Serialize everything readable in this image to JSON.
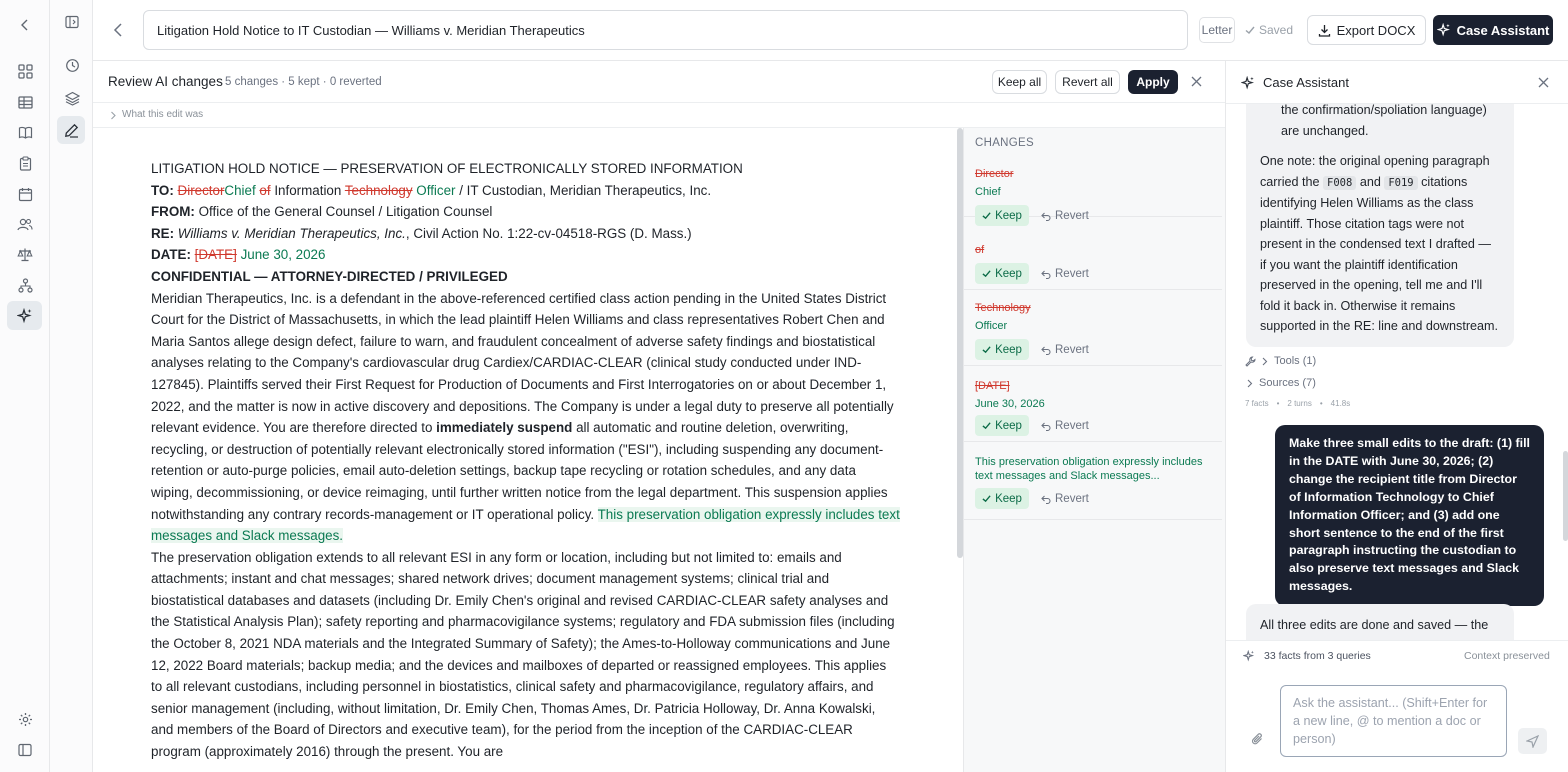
{
  "colors": {
    "accent_dark": "#1b2130",
    "deleted": "#d0392e",
    "inserted": "#0b7a52",
    "keep_bg": "#dcf2e4"
  },
  "rail": {
    "items": [
      {
        "icon": "chevron-left-icon"
      },
      {
        "icon": "grid-icon"
      },
      {
        "icon": "table-icon"
      },
      {
        "icon": "book-icon"
      },
      {
        "icon": "clipboard-icon"
      },
      {
        "icon": "calendar-icon"
      },
      {
        "icon": "users-icon"
      },
      {
        "icon": "scale-icon"
      },
      {
        "icon": "org-chart-icon"
      },
      {
        "icon": "sparkle-icon"
      },
      {
        "icon": "gear-icon"
      },
      {
        "icon": "panel-collapse-icon"
      }
    ]
  },
  "subrail": {
    "items": [
      {
        "icon": "panel-toggle-icon"
      },
      {
        "icon": "history-icon"
      },
      {
        "icon": "layers-icon"
      },
      {
        "icon": "pen-icon"
      }
    ]
  },
  "header": {
    "document_title": "Litigation Hold Notice to IT Custodian — Williams v. Meridian Therapeutics",
    "doc_type": "Letter",
    "saved_status": "Saved",
    "export_label": "Export DOCX",
    "assistant_label": "Case Assistant"
  },
  "review": {
    "title": "Review AI changes",
    "summary": "5 changes · 5 kept · 0 reverted",
    "keep_all": "Keep all",
    "revert_all": "Revert all",
    "apply": "Apply",
    "what_this_edit_was": "What this edit was"
  },
  "document": {
    "heading": "LITIGATION HOLD NOTICE — PRESERVATION OF ELECTRONICALLY STORED INFORMATION",
    "to_label": "TO:",
    "to_del_1": "Director",
    "to_ins_1": "Chief",
    "to_del_2": "of",
    "to_text_1": "Information",
    "to_del_3": "Technology",
    "to_ins_3": "Officer",
    "to_text_2": "/ IT Custodian, Meridian Therapeutics, Inc.",
    "from_label": "FROM:",
    "from_text": "Office of the General Counsel / Litigation Counsel",
    "re_label": "RE:",
    "re_case": "Williams v. Meridian Therapeutics, Inc.",
    "re_text": ", Civil Action No. 1:22-cv-04518-RGS (D. Mass.)",
    "date_label": "DATE:",
    "date_del": "[DATE]",
    "date_ins": "June 30, 2026",
    "confidential": "CONFIDENTIAL — ATTORNEY-DIRECTED / PRIVILEGED",
    "p1_a": "Meridian Therapeutics, Inc. is a defendant in the above-referenced certified class action pending in the United States District Court for the District of Massachusetts, in which the lead plaintiff Helen Williams and class representatives Robert Chen and Maria Santos allege design defect, failure to warn, and fraudulent concealment of adverse safety findings and biostatistical analyses relating to the Company's cardiovascular drug Cardiex/CARDIAC-CLEAR (clinical study conducted under IND-127845). Plaintiffs served their First Request for Production of Documents and First Interrogatories on or about December 1, 2022, and the matter is now in active discovery and depositions. The Company is under a legal duty to preserve all potentially relevant evidence. You are therefore directed to",
    "p1_bold": "immediately suspend",
    "p1_b": "all automatic and routine deletion, overwriting, recycling, or destruction of potentially relevant electronically stored information (\"ESI\"), including suspending any document-retention or auto-purge policies, email auto-deletion settings, backup tape recycling or rotation schedules, and any data wiping, decommissioning, or device reimaging, until further written notice from the legal department. This suspension applies notwithstanding any contrary records-management or IT operational policy.",
    "p1_ins": "This preservation obligation expressly includes text messages and Slack messages.",
    "p2": "The preservation obligation extends to all relevant ESI in any form or location, including but not limited to: emails and attachments; instant and chat messages; shared network drives; document management systems; clinical trial and biostatistical databases and datasets (including Dr. Emily Chen's original and revised CARDIAC-CLEAR safety analyses and the Statistical Analysis Plan); safety reporting and pharmacovigilance systems; regulatory and FDA submission files (including the October 8, 2021 NDA materials and the Integrated Summary of Safety); the Ames-to-Holloway communications and June 12, 2022 Board materials; backup media; and the devices and mailboxes of departed or reassigned employees. This applies to all relevant custodians, including personnel in biostatistics, clinical safety and pharmacovigilance, regulatory affairs, and senior management (including, without limitation, Dr. Emily Chen, Thomas Ames, Dr. Patricia Holloway, Dr. Anna Kowalski, and members of the Board of Directors and executive team), for the period from the inception of the CARDIAC-CLEAR program (approximately 2016) through the present. You are"
  },
  "changes": {
    "heading": "CHANGES",
    "keep_label": "Keep",
    "revert_label": "Revert",
    "items": [
      {
        "deleted": "Director",
        "inserted": "Chief"
      },
      {
        "deleted": "of",
        "inserted": ""
      },
      {
        "deleted": "Technology",
        "inserted": "Officer"
      },
      {
        "deleted": "[DATE]",
        "inserted": "June 30, 2026"
      },
      {
        "deleted": "",
        "inserted": "This preservation obligation expressly includes text messages and Slack messages..."
      }
    ]
  },
  "assistant": {
    "title": "Case Assistant",
    "msg1_top_a": "the confirmation/spoliation language)",
    "msg1_top_b": "are unchanged.",
    "msg1_p_a": "One note: the original opening paragraph carried the",
    "msg1_code1": "F008",
    "msg1_and": "and",
    "msg1_code2": "F019",
    "msg1_p_b": "citations identifying Helen Williams as the class plaintiff. Those citation tags were not present in the condensed text I drafted — if you want the plaintiff identification preserved in the opening, tell me and I'll fold it back in. Otherwise it remains supported in the RE: line and downstream.",
    "tools": "Tools (1)",
    "sources": "Sources (7)",
    "meta_facts": "7 facts",
    "meta_turns": "2 turns",
    "meta_time": "41.8s",
    "user_msg": "Make three small edits to the draft: (1) fill in the DATE with June 30, 2026; (2) change the recipient title from Director of Information Technology to Chief Information Officer; and (3) add one short sentence to the end of the first paragraph instructing the custodian to also preserve text messages and Slack messages.",
    "msg2_start": "All three edits are done and saved — the",
    "facts_footer": "33 facts from 3 queries",
    "context": "Context preserved",
    "composer_placeholder": "Ask the assistant... (Shift+Enter for a new line, @ to mention a doc or person)"
  }
}
